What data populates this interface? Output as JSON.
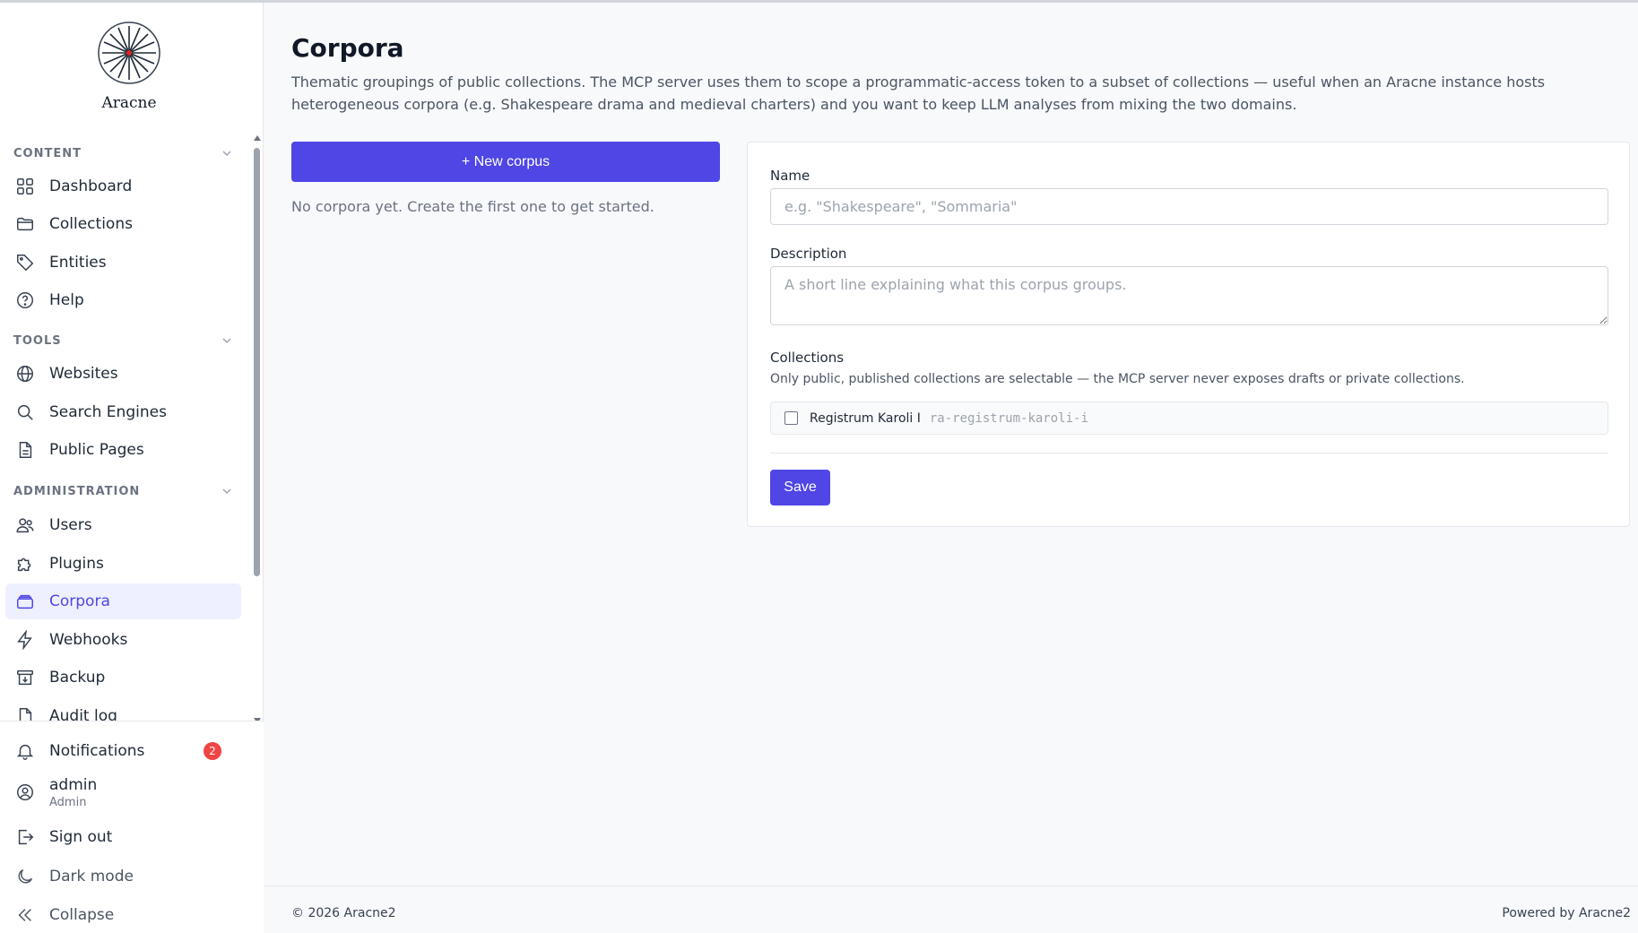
{
  "app": {
    "name": "Aracne"
  },
  "sidebar": {
    "sections": [
      {
        "title": "CONTENT",
        "items": [
          {
            "label": "Dashboard",
            "icon": "grid-icon"
          },
          {
            "label": "Collections",
            "icon": "folder-icon"
          },
          {
            "label": "Entities",
            "icon": "tag-icon"
          },
          {
            "label": "Help",
            "icon": "help-circle-icon"
          }
        ]
      },
      {
        "title": "TOOLS",
        "items": [
          {
            "label": "Websites",
            "icon": "globe-icon"
          },
          {
            "label": "Search Engines",
            "icon": "search-icon"
          },
          {
            "label": "Public Pages",
            "icon": "document-icon"
          }
        ]
      },
      {
        "title": "ADMINISTRATION",
        "items": [
          {
            "label": "Users",
            "icon": "users-icon"
          },
          {
            "label": "Plugins",
            "icon": "puzzle-icon"
          },
          {
            "label": "Corpora",
            "icon": "stack-icon",
            "active": true
          },
          {
            "label": "Webhooks",
            "icon": "bolt-icon"
          },
          {
            "label": "Backup",
            "icon": "archive-icon"
          },
          {
            "label": "Audit log",
            "icon": "log-icon"
          }
        ]
      }
    ],
    "bottom": {
      "notifications": {
        "label": "Notifications",
        "count": "2"
      },
      "user": {
        "name": "admin",
        "role": "Admin"
      },
      "sign_out": "Sign out",
      "dark_mode": "Dark mode",
      "collapse": "Collapse"
    }
  },
  "page": {
    "title": "Corpora",
    "description": "Thematic groupings of public collections. The MCP server uses them to scope a programmatic-access token to a subset of collections — useful when an Aracne instance hosts heterogeneous corpora (e.g. Shakespeare drama and medieval charters) and you want to keep LLM analyses from mixing the two domains.",
    "new_button": "+ New corpus",
    "empty_note": "No corpora yet. Create the first one to get started."
  },
  "form": {
    "name_label": "Name",
    "name_placeholder": "e.g. \"Shakespeare\", \"Sommaria\"",
    "name_value": "",
    "description_label": "Description",
    "description_placeholder": "A short line explaining what this corpus groups.",
    "collections_label": "Collections",
    "collections_help": "Only public, published collections are selectable — the MCP server never exposes drafts or private collections.",
    "collections": [
      {
        "name": "Registrum Karoli I",
        "slug": "ra-registrum-karoli-i",
        "checked": false
      }
    ],
    "save_label": "Save"
  },
  "footer": {
    "copyright": "© 2026 Aracne2",
    "powered": "Powered by Aracne2"
  },
  "colors": {
    "accent": "#4f46e5",
    "active_bg": "#eef0ff",
    "badge": "#ef4444"
  }
}
